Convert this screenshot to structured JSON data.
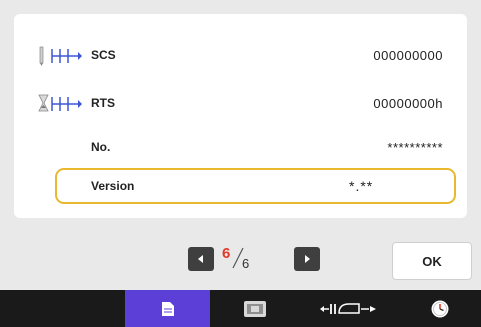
{
  "info_rows": [
    {
      "icon": "needle-stitch-icon",
      "label": "SCS",
      "value": "000000000"
    },
    {
      "icon": "hourglass-stitch-icon",
      "label": "RTS",
      "value": "00000000h"
    },
    {
      "icon": "",
      "label": "No.",
      "value": "**********"
    }
  ],
  "version": {
    "label": "Version",
    "value": "*.**"
  },
  "pager": {
    "current": "6",
    "total": "6",
    "prev_icon": "arrow-left-icon",
    "next_icon": "arrow-right-icon"
  },
  "ok_button": {
    "label": "OK"
  },
  "taskbar": {
    "items": [
      {
        "icon": "blank-icon"
      },
      {
        "icon": "document-icon",
        "active": true
      },
      {
        "icon": "screen-settings-icon"
      },
      {
        "icon": "presser-foot-icon"
      },
      {
        "icon": "clock-icon"
      }
    ]
  },
  "colors": {
    "highlight_border": "#e8b92f",
    "current_page": "#e03a2b",
    "taskbar_active": "#5b3fd6",
    "taskbar_bg": "#1a1a1a",
    "stitch_icon_blue": "#3a56d6"
  }
}
